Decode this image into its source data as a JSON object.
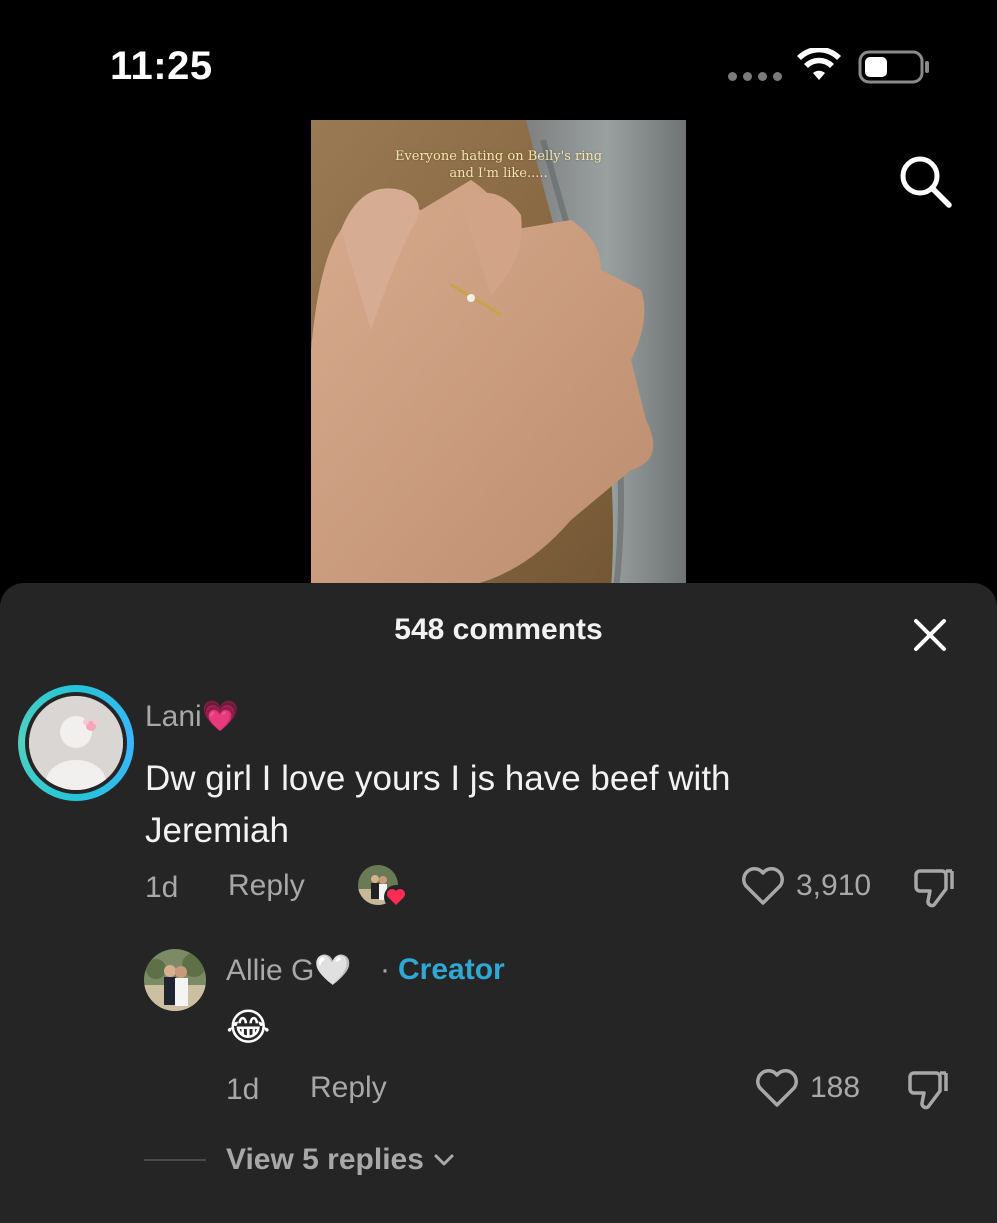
{
  "status_bar": {
    "time": "11:25",
    "icons": [
      "signal-dots-icon",
      "wifi-icon",
      "battery-icon"
    ]
  },
  "header": {
    "search_icon": "search-icon"
  },
  "video": {
    "caption_line1": "Everyone hating on Belly's ring",
    "caption_line2": "and I'm like....."
  },
  "comments": {
    "count_title": "548 comments",
    "close_icon": "close-icon",
    "top_comment": {
      "author": "Lani💗",
      "text": "Dw girl I love yours I js have beef with Jeremiah",
      "age": "1d",
      "reply_label": "Reply",
      "likes": "3,910",
      "creator_liked": true
    },
    "reply": {
      "author": "Allie G🤍",
      "separator": "·",
      "badge": "Creator",
      "text": "😂",
      "age": "1d",
      "reply_label": "Reply",
      "likes": "188"
    },
    "view_replies_label": "View 5 replies"
  },
  "colors": {
    "sheet_bg": "#252525",
    "creator_accent": "#2fa8d5",
    "avatar_ring": "#25c4d8",
    "muted_text": "#a8a8a8"
  }
}
